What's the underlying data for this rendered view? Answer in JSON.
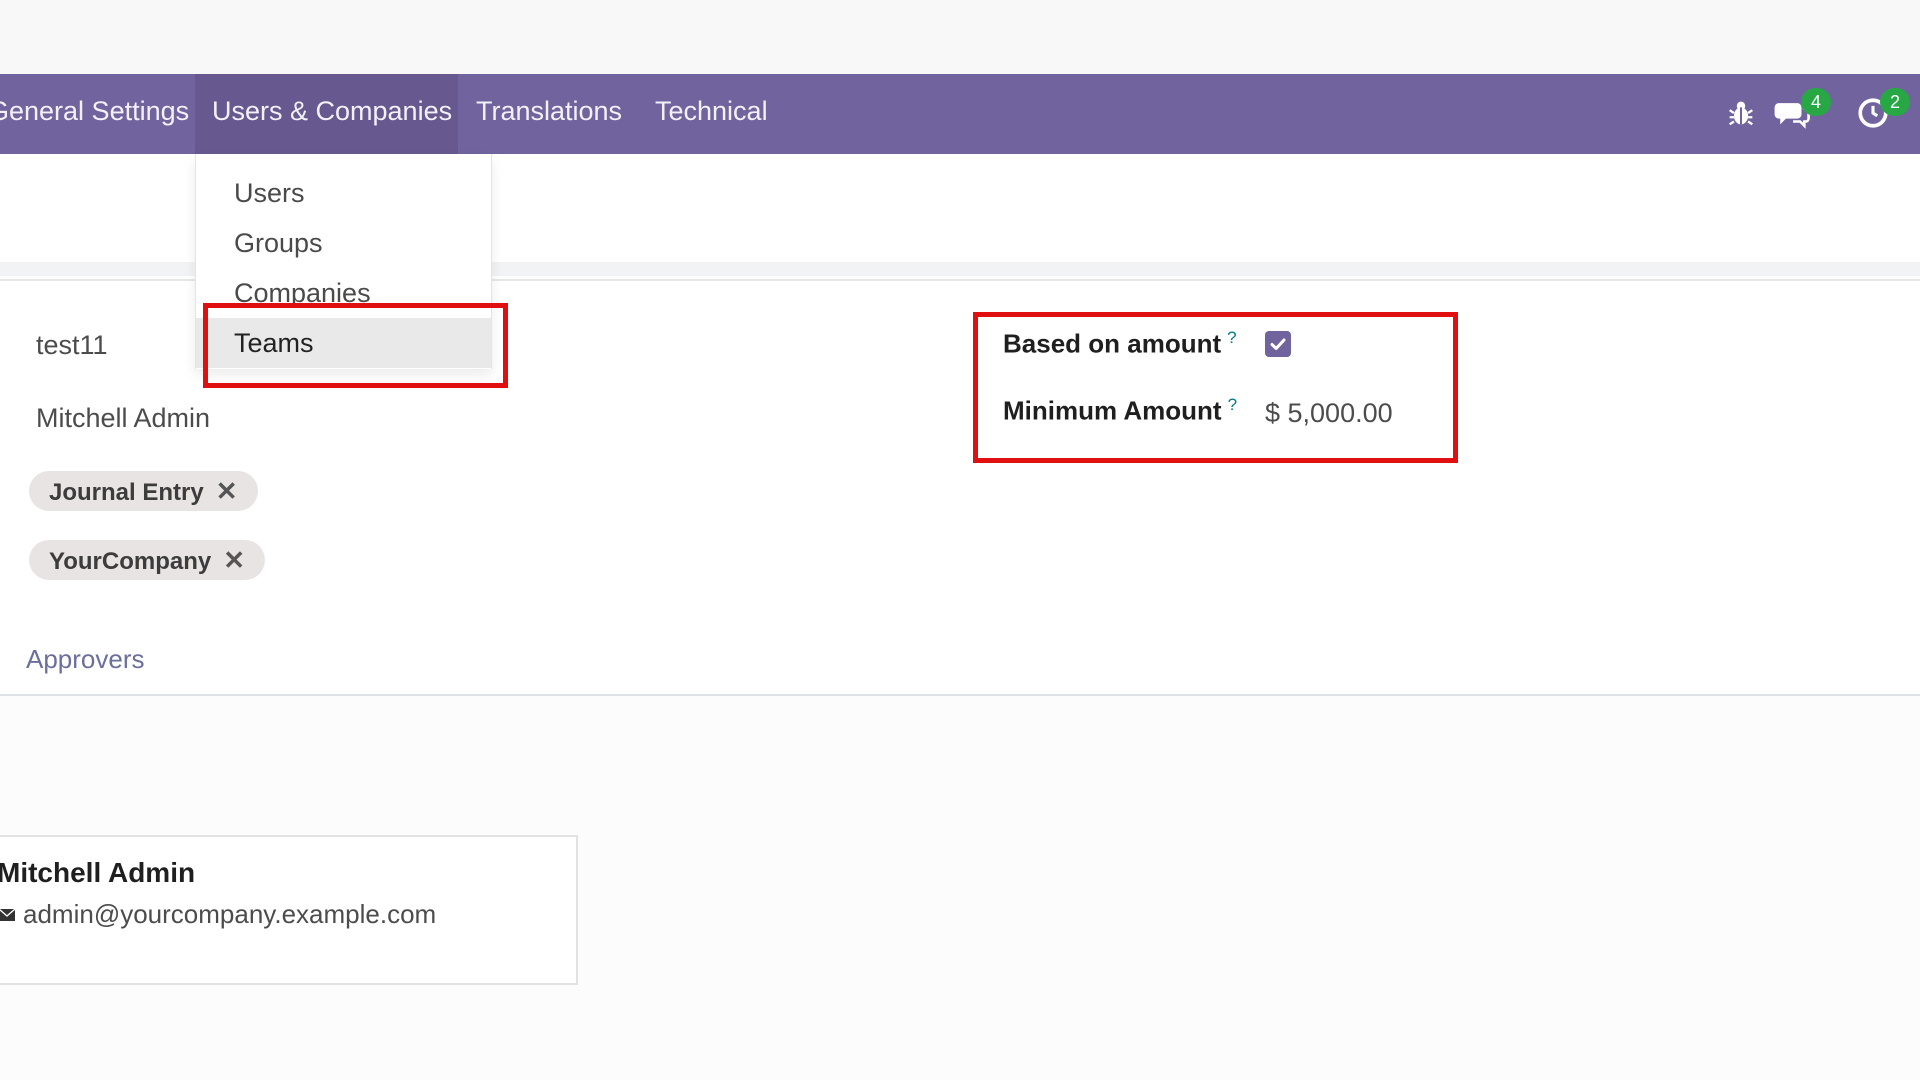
{
  "navbar": {
    "menus": [
      "General Settings",
      "Users & Companies",
      "Translations",
      "Technical"
    ],
    "messages_count": "4",
    "activities_count": "2",
    "icons": [
      "bug-icon",
      "chat-icon",
      "clock-icon"
    ]
  },
  "dropdown": {
    "items": [
      "Users",
      "Groups",
      "Companies",
      "Teams"
    ]
  },
  "form": {
    "name": "test11",
    "responsible": "Mitchell Admin",
    "tags": [
      "Journal Entry",
      "YourCompany"
    ],
    "based_on_amount_label": "Based on amount",
    "based_on_amount_checked": true,
    "minimum_amount_label": "Minimum Amount",
    "minimum_amount_value": "$ 5,000.00",
    "help_mark": "?"
  },
  "tabs": {
    "approvers": "Approvers"
  },
  "approver_card": {
    "name": "Mitchell Admin",
    "email": "admin@yourcompany.example.com"
  },
  "colors": {
    "navbar": "#71639e",
    "badge": "#28a745",
    "highlight": "#e01010",
    "checkbox": "#71639e"
  }
}
